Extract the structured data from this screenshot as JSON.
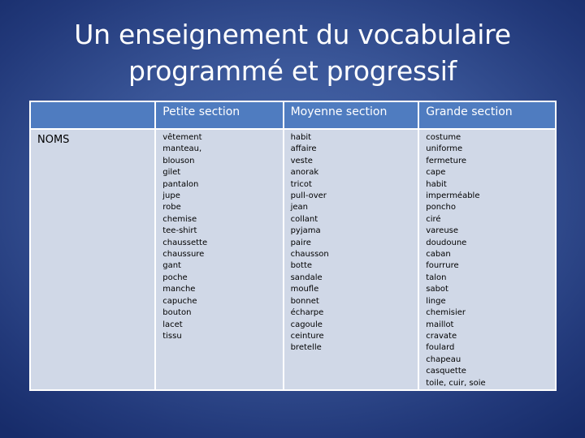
{
  "slide": {
    "title_lines": [
      "Un enseignement du vocabulaire",
      "programmé et progressif"
    ]
  },
  "table": {
    "headers": [
      "",
      "Petite section",
      "Moyenne section",
      "Grande section"
    ],
    "rows": [
      {
        "label": "NOMS",
        "columns": [
          [
            "vêtement",
            "manteau,",
            "blouson",
            "gilet",
            "pantalon",
            "jupe",
            "robe",
            "chemise",
            "tee-shirt",
            "chaussette",
            "chaussure",
            "gant",
            "poche",
            "manche",
            "capuche",
            "bouton",
            "lacet",
            "tissu"
          ],
          [
            "habit",
            "affaire",
            "veste",
            "anorak",
            "tricot",
            "pull-over",
            "jean",
            "collant",
            "pyjama",
            "paire",
            "chausson",
            "botte",
            "sandale",
            "moufle",
            "bonnet",
            "écharpe",
            "cagoule",
            "ceinture",
            "bretelle"
          ],
          [
            "costume",
            "uniforme",
            "fermeture",
            "cape",
            "habit",
            "imperméable",
            "poncho",
            "ciré",
            "vareuse",
            "doudoune",
            "caban",
            "fourrure",
            "talon",
            "sabot",
            "linge",
            "chemisier",
            "maillot",
            "cravate",
            "foulard",
            "chapeau",
            "casquette",
            "toile, cuir, soie"
          ]
        ]
      }
    ]
  },
  "colors": {
    "background": "#2d4a8c",
    "header_fill": "#4f7cc0",
    "cell_fill": "#d0d8e7",
    "border": "#ffffff"
  }
}
